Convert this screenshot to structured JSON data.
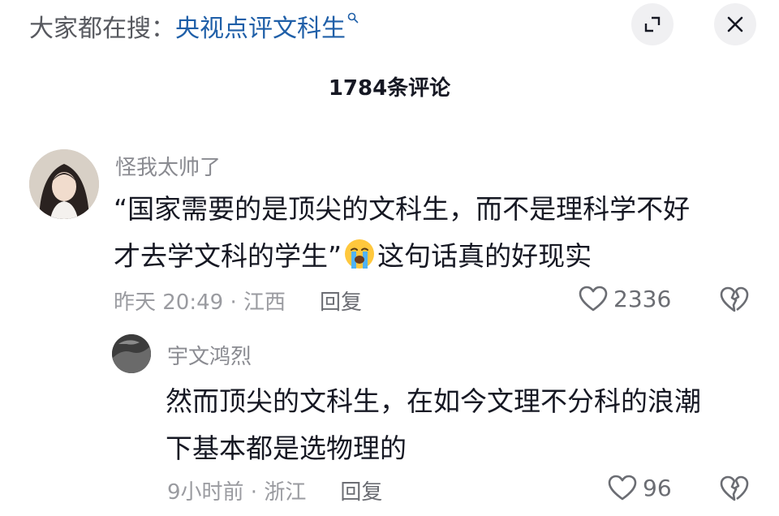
{
  "header": {
    "search_prefix": "大家都在搜：",
    "search_term": "央视点评文科生",
    "search_icon": "search-icon",
    "expand_icon": "expand-icon",
    "close_icon": "close-icon"
  },
  "comment_count": "1784条评论",
  "comments": [
    {
      "username": "怪我太帅了",
      "text_line1": "“国家需要的是顶尖的文科生，而不是理科学不好",
      "text_line2a": "才去学文科的学生”",
      "emoji": "loudly-crying-face-emoji",
      "text_line2b": "这句话真的好现实",
      "time_location": "昨天 20:49 · 江西",
      "reply_label": "回复",
      "likes": "2336"
    },
    {
      "username": "宇文鸿烈",
      "text_line1": "然而顶尖的文科生，在如今文理不分科的浪潮",
      "text_line2": "下基本都是选物理的",
      "time_location": "9小时前 · 浙江",
      "reply_label": "回复",
      "likes": "96"
    }
  ],
  "colors": {
    "accent": "#1f5fa8",
    "text": "#161823",
    "muted": "#8a8b91",
    "button_bg": "#f0f0f2"
  }
}
